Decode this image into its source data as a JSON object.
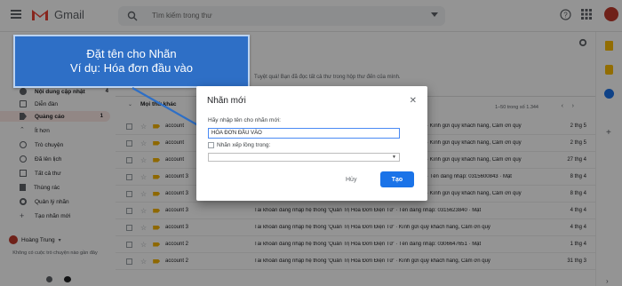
{
  "app": {
    "name": "Gmail"
  },
  "search": {
    "placeholder": "Tìm kiếm trong thư"
  },
  "sidebar": {
    "items": [
      {
        "label": "Nội dung cập nhật",
        "count": "4",
        "bold": true
      },
      {
        "label": "Diễn đàn",
        "count": ""
      },
      {
        "label": "Quảng cáo",
        "count": "1",
        "bold": true
      },
      {
        "label": "Ít hơn",
        "count": ""
      },
      {
        "label": "Trò chuyện",
        "count": ""
      },
      {
        "label": "Đã lên lịch",
        "count": ""
      },
      {
        "label": "Tất cả thư",
        "count": ""
      },
      {
        "label": "Thùng rác",
        "count": ""
      },
      {
        "label": "Quản lý nhãn",
        "count": ""
      },
      {
        "label": "Tạo nhãn mới",
        "count": ""
      }
    ],
    "user": "Hoàng Trung",
    "chat_empty": "Không có cuộc trò chuyện nào gần đây"
  },
  "main": {
    "notice": "Tuyệt quá! Bạn đã đọc tất cả thư trong hộp thư đến của mình.",
    "section_label": "Mọi thứ khác",
    "range": "1–50 trong số 1.344",
    "rows": [
      {
        "sender": "account",
        "subject": "· Kính gửi quý khách hàng, Cảm ơn quý",
        "date": "2 thg 5"
      },
      {
        "sender": "account",
        "subject": "· Kính gửi quý khách hàng, Cảm ơn quý",
        "date": "2 thg 5"
      },
      {
        "sender": "account",
        "subject": "· Kính gửi quý khách hàng, Cảm ơn quý",
        "date": "27 thg 4"
      },
      {
        "sender": "account 3",
        "subject": "· Tên đăng nhập: 0315600843 · Mật",
        "date": "8 thg 4"
      },
      {
        "sender": "account 3",
        "subject": "· Kính gửi quý khách hàng, Cảm ơn quý",
        "date": "8 thg 4"
      },
      {
        "sender": "account 3",
        "subject": "Tài khoản đăng nhập hệ thống 'Quản Trị Hóa Đơn Điện Tử' · Tên đăng nhập: 0315623840 · Mật",
        "date": "4 thg 4"
      },
      {
        "sender": "account 3",
        "subject": "Tài khoản đăng nhập hệ thống 'Quản Trị Hóa Đơn Điện Tử' · Kính gửi quý khách hàng, Cảm ơn quý",
        "date": "4 thg 4"
      },
      {
        "sender": "account 2",
        "subject": "Tài khoản đăng nhập hệ thống 'Quản Trị Hóa Đơn Điện Tử' · Tên đăng nhập: 0306647651 · Mật",
        "date": "1 thg 4"
      },
      {
        "sender": "account 2",
        "subject": "Tài khoản đăng nhập hệ thống 'Quản Trị Hóa Đơn Điện Tử' · Kính gửi quý khách hàng, Cảm ơn quý",
        "date": "31 thg 3"
      }
    ]
  },
  "callout": {
    "line1": "Đặt tên cho Nhãn",
    "line2": "Ví dụ: Hóa đơn đầu vào"
  },
  "dialog": {
    "title": "Nhãn mới",
    "name_label": "Hãy nhập tên cho nhãn mới:",
    "name_value": "HÓA ĐƠN ĐẦU VÀO",
    "nest_label": "Nhãn xếp lồng trong:",
    "cancel": "Hủy",
    "create": "Tạo"
  },
  "colors": {
    "accent": "#1a73e8",
    "callout": "#2e6fc6",
    "gmail_red": "#ea4335"
  }
}
